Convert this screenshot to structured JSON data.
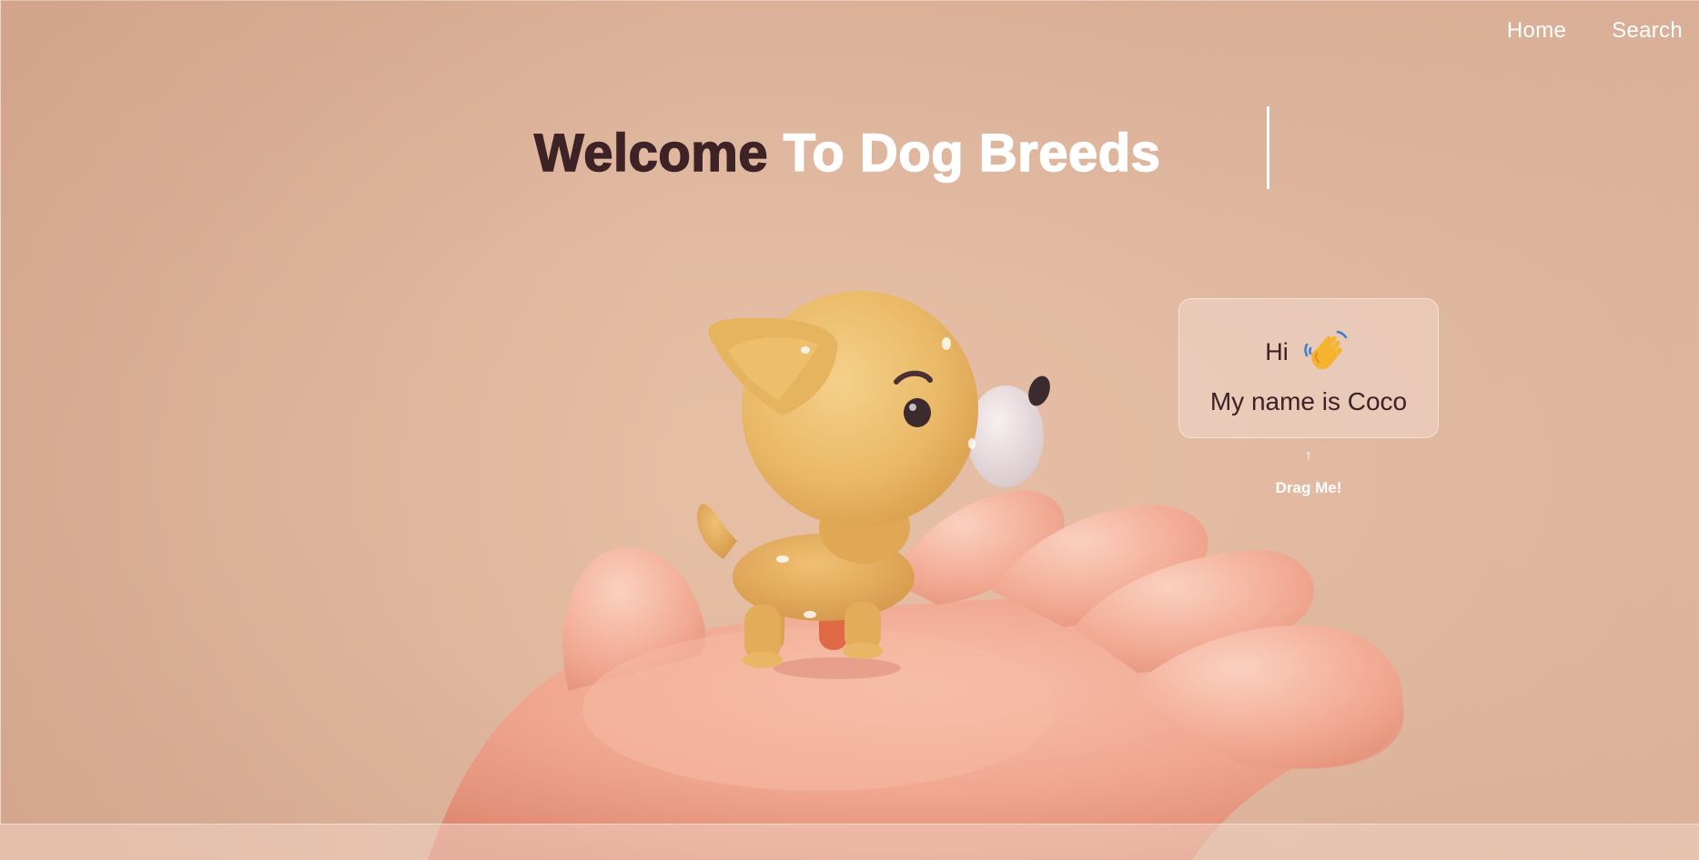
{
  "nav": {
    "home_label": "Home",
    "search_label": "Search"
  },
  "hero": {
    "title_part1": "Welcome",
    "title_part2": "To Dog Breeds"
  },
  "chat_card": {
    "greeting": "Hi",
    "greeting_icon": "waving-hand-icon",
    "name_line": "My name is Coco"
  },
  "drag_hint": {
    "arrow": "↑",
    "label": "Drag Me!"
  },
  "colors": {
    "background": "#e2bba2",
    "title_dark": "#3d2226",
    "title_light": "#ffffff",
    "hand": "#f0a28a",
    "dog": "#e9b866"
  }
}
